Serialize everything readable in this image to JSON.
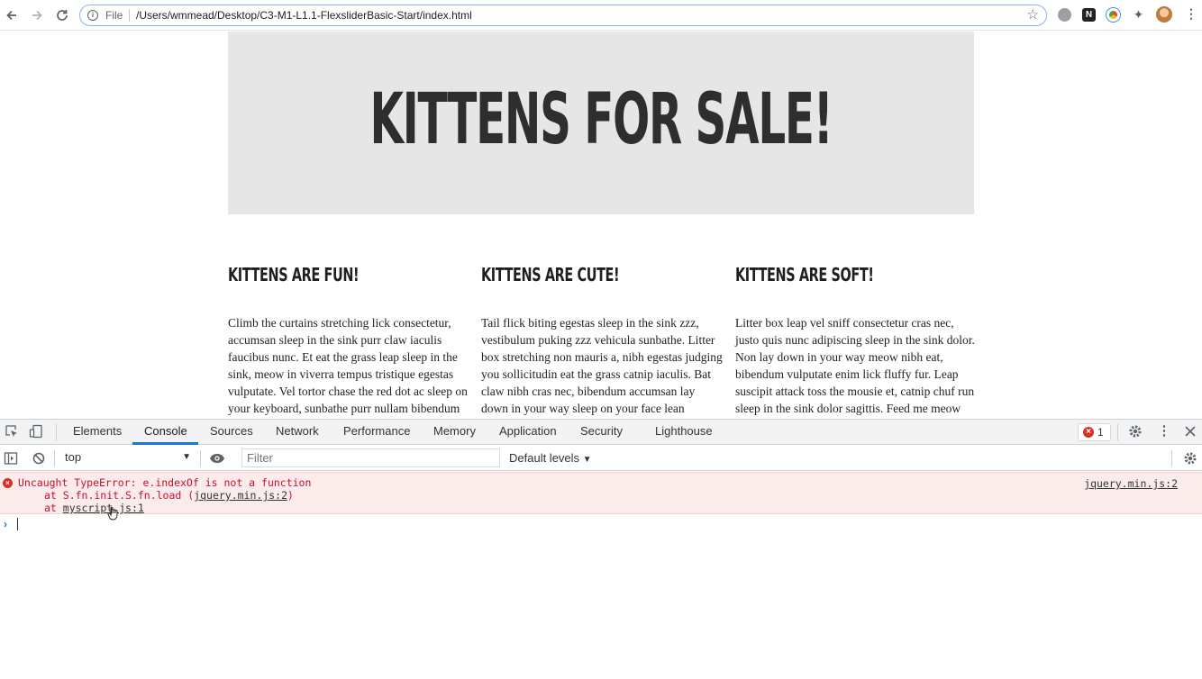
{
  "browser": {
    "scheme_label": "File",
    "url": "/Users/wmmead/Desktop/C3-M1-L1.1-FlexsliderBasic-Start/index.html"
  },
  "page": {
    "hero_title": "KITTENS FOR SALE!",
    "columns": [
      {
        "heading": "KITTENS ARE FUN!",
        "text": "Climb the curtains stretching lick consectetur, accumsan sleep in the sink purr claw iaculis faucibus nunc. Et eat the grass leap sleep in the sink, meow in viverra tempus tristique egestas vulputate. Vel tortor chase the red dot ac sleep on your keyboard, sunbathe purr nullam bibendum sollicitudin feed me."
      },
      {
        "heading": "KITTENS ARE CUTE!",
        "text": "Tail flick biting egestas sleep in the sink zzz, vestibulum puking zzz vehicula sunbathe. Litter box stretching non mauris a, nibh egestas judging you sollicitudin eat the grass catnip iaculis. Bat claw nibh cras nec, bibendum accumsan lay down in your way sleep on your face lean scratched consectetur."
      },
      {
        "heading": "KITTENS ARE SOFT!",
        "text": "Litter box leap vel sniff consectetur cras nec, justo quis nunc adipiscing sleep in the sink dolor. Non lay down in your way meow nibh eat, bibendum vulputate enim lick fluffy fur. Leap suscipit attack toss the mousie et, catnip chuf run sleep in the sink dolor sagittis. Feed me meow attack chuf rhoncus give me fish."
      }
    ]
  },
  "devtools": {
    "tabs": [
      "Elements",
      "Console",
      "Sources",
      "Network",
      "Performance",
      "Memory",
      "Application",
      "Security",
      "Lighthouse"
    ],
    "active_tab": "Console",
    "error_count": "1",
    "context": "top",
    "filter_placeholder": "Filter",
    "levels": "Default levels",
    "error": {
      "message": "Uncaught TypeError: e.indexOf is not a function",
      "stack1_prefix": "at S.fn.init.S.fn.load (",
      "stack1_link": "jquery.min.js:2",
      "stack1_suffix": ")",
      "stack2_prefix": "at ",
      "stack2_link": "myscript.js:1",
      "source": "jquery.min.js:2"
    },
    "prompt_symbol": "›"
  },
  "colors": {
    "accent": "#1a73e8",
    "error_red": "#d93025",
    "error_bg": "#fcebeb",
    "hero_bg": "#e6e6e6"
  }
}
